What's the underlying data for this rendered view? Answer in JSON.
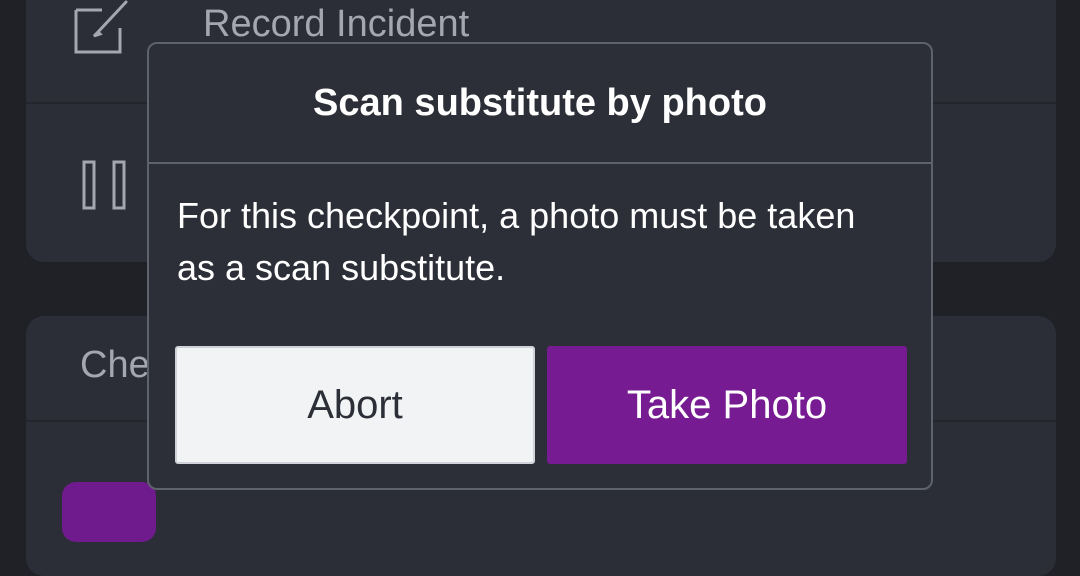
{
  "background": {
    "top_card": {
      "record_incident_label": "Record Incident"
    },
    "bottom_card": {
      "partial_label": "Che"
    }
  },
  "dialog": {
    "title": "Scan substitute by photo",
    "message": "For this checkpoint, a photo must be taken as a scan substitute.",
    "abort_label": "Abort",
    "take_photo_label": "Take Photo"
  },
  "colors": {
    "accent": "#761b91",
    "dialog_bg": "#2c2f37",
    "app_bg": "#1f2127",
    "card_bg": "#2b2e36"
  },
  "icons": {
    "record_incident": "edit-icon",
    "pause": "pause-icon"
  }
}
